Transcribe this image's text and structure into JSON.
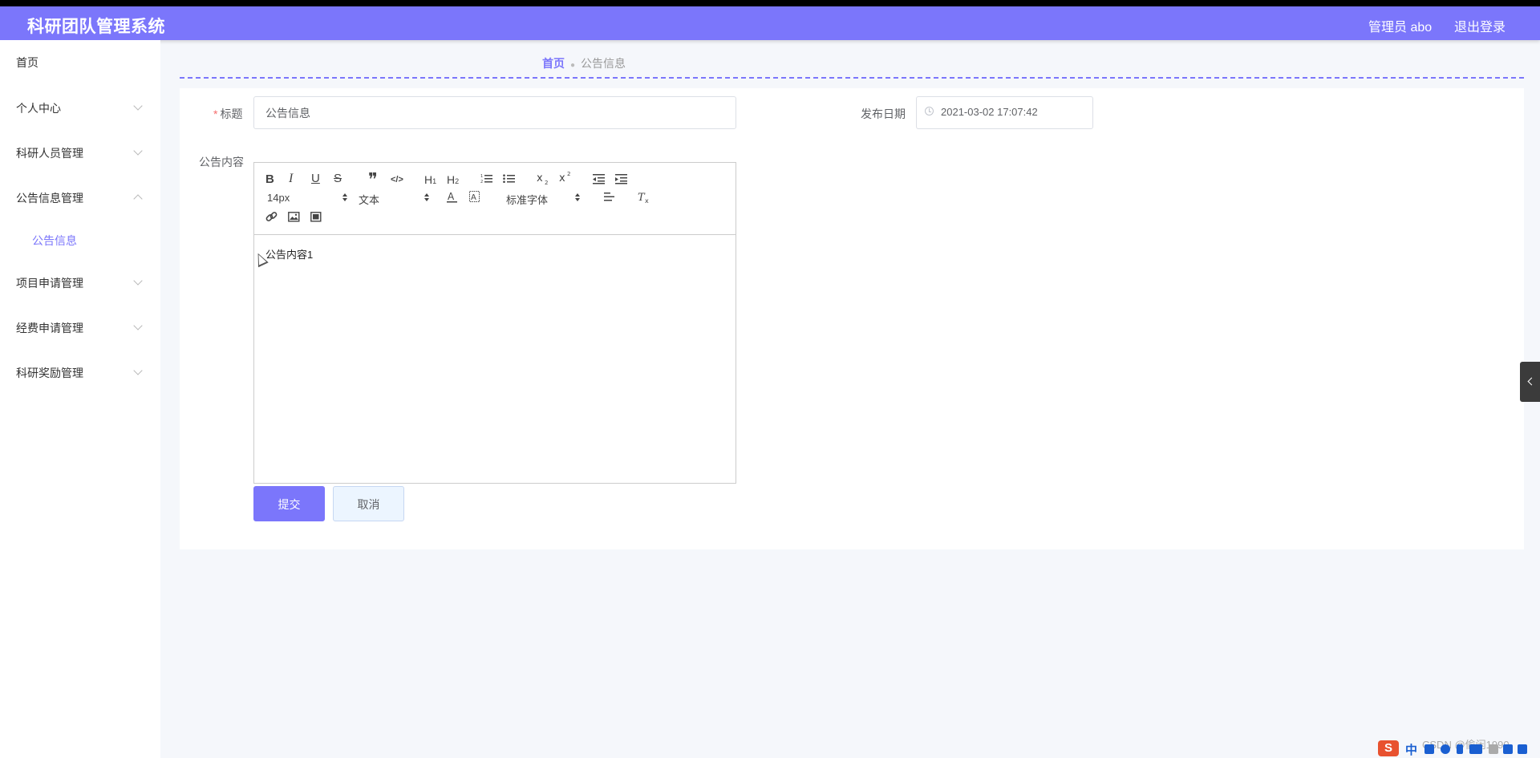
{
  "header": {
    "title": "科研团队管理系统",
    "user_label": "管理员 abo",
    "logout_label": "退出登录"
  },
  "sidebar": {
    "items": [
      {
        "label": "首页"
      },
      {
        "label": "个人中心"
      },
      {
        "label": "科研人员管理"
      },
      {
        "label": "公告信息管理"
      },
      {
        "label": "项目申请管理"
      },
      {
        "label": "经费申请管理"
      },
      {
        "label": "科研奖励管理"
      }
    ],
    "subitem": {
      "label": "公告信息"
    }
  },
  "breadcrumb": {
    "home": "首页",
    "current": "公告信息"
  },
  "form": {
    "title_label": "标题",
    "title_value": "公告信息",
    "date_label": "发布日期",
    "date_value": "2021-03-02 17:07:42",
    "content_label": "公告内容",
    "content_value": "公告内容1",
    "submit_label": "提交",
    "cancel_label": "取消"
  },
  "editor": {
    "toolbar": {
      "bold": "B",
      "italic": "I",
      "underline": "U",
      "strike": "S",
      "blockquote": "❞",
      "code": "</>",
      "h1": "H",
      "h1_sub": "1",
      "h2": "H",
      "h2_sub": "2",
      "font_size": "14px",
      "header_select": "文本",
      "font_family": "标准字体"
    }
  },
  "colors": {
    "accent": "#7b76fb",
    "header_bg": "#7b76fb",
    "required": "#f56c6c"
  },
  "watermark": "CSDN @偷闲1990",
  "ime": {
    "logo": "S",
    "mode": "中"
  }
}
